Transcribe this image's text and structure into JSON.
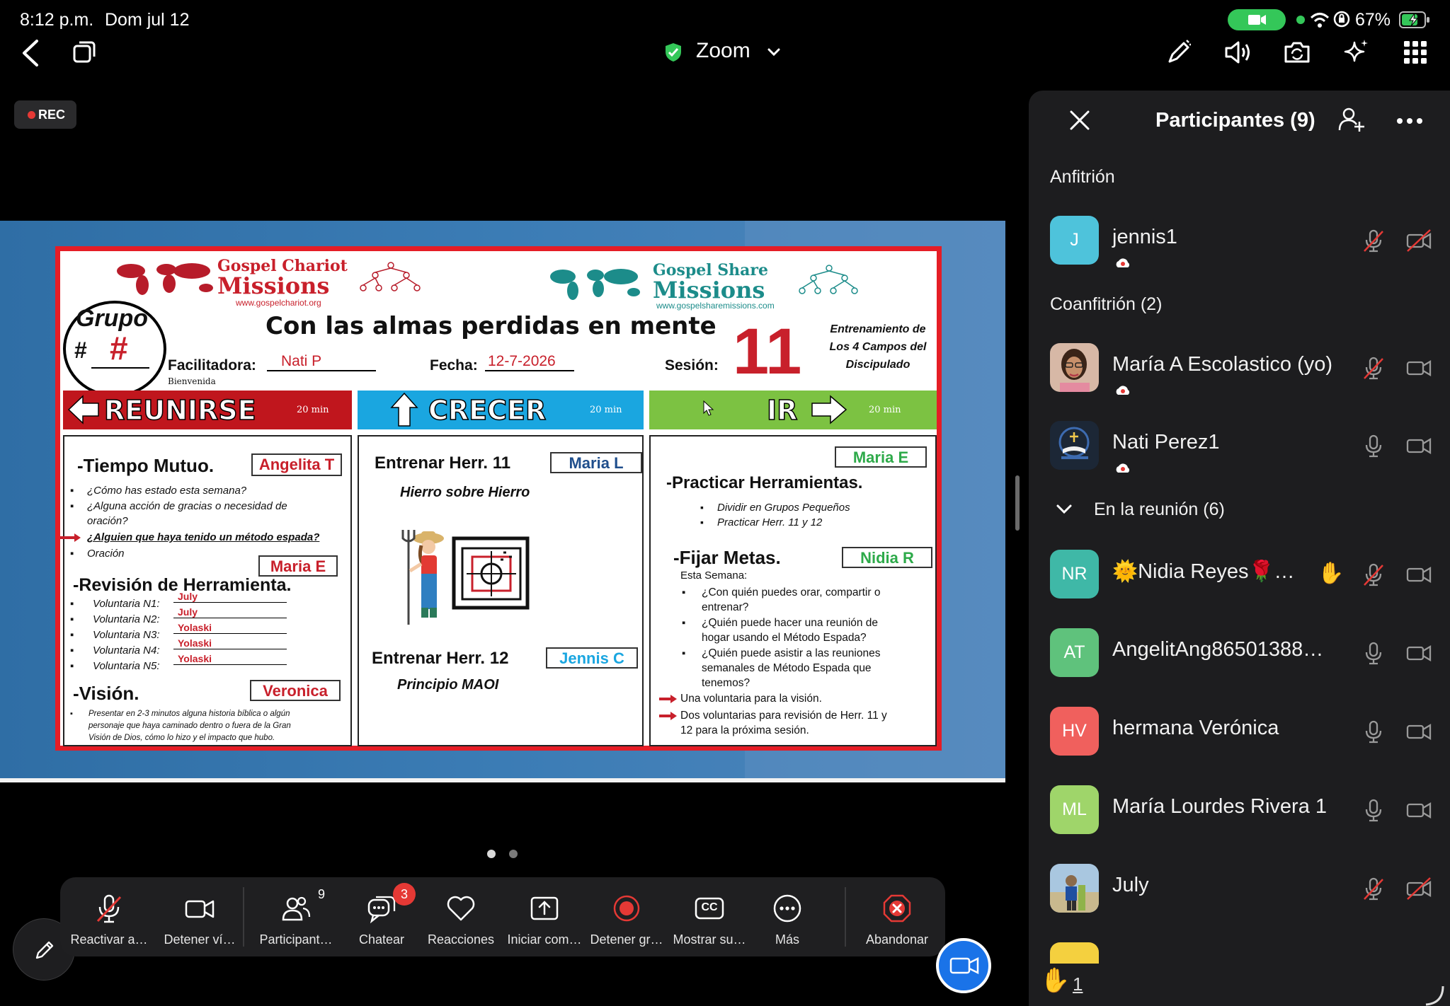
{
  "status_bar": {
    "time": "8:12 p.m.",
    "date": "Dom jul 12",
    "battery": "67%"
  },
  "top_bar": {
    "title": "Zoom"
  },
  "rec_badge": "REC",
  "slide": {
    "chariot_title": "Gospel Chariot",
    "chariot_missions": "Missions",
    "chariot_url": "www.gospelchariot.org",
    "share_title": "Gospel Share",
    "share_missions": "Missions",
    "share_url": "www.gospelsharemissions.com",
    "grupo": "Grupo",
    "grupo_hash": "#",
    "grupo_num": "#",
    "main_title": "Con las almas perdidas en mente",
    "training_1": "Entrenamiento de",
    "training_2": "Los 4 Campos del",
    "training_3": "Discipulado",
    "facilitadora_label": "Facilitadora:",
    "facilitadora_value": "Nati P",
    "bienvenida": "Bienvenida",
    "fecha_label": "Fecha:",
    "fecha_value": "12-7-2026",
    "sesion_label": "Sesión:",
    "sesion_value": "11",
    "bar_reunirse": "REUNIRSE",
    "bar_crecer": "CRECER",
    "bar_ir": "IR",
    "bar_min": "20 min",
    "col1": {
      "h1": "-Tiempo Mutuo.",
      "b1": "Angelita T",
      "l1": "¿Cómo has estado esta semana?",
      "l2": "¿Alguna acción de gracias o necesidad de",
      "l3": "oración?",
      "l4": "¿Alguien que haya tenido un método espada?",
      "l5": "Oración",
      "b2": "Maria E",
      "h2": "-Revisión de Herramienta.",
      "v1": "Voluntaria N1:",
      "v1n": "July",
      "v2": "Voluntaria N2:",
      "v2n": "July",
      "v3": "Voluntaria N3:",
      "v3n": "Yolaski",
      "v4": "Voluntaria N4:",
      "v4n": "Yolaski",
      "v5": "Voluntaria N5:",
      "v5n": "Yolaski",
      "h3": "-Visión.",
      "b3": "Veronica",
      "p1": "Presentar en 2-3 minutos alguna historia bíblica o algún",
      "p2": "personaje que haya caminado dentro o fuera de la Gran",
      "p3": "Visión de Dios, cómo lo hizo y el impacto que hubo."
    },
    "col2": {
      "h1": "Entrenar Herr. 11",
      "b1": "Maria L",
      "s1": "Hierro sobre Hierro",
      "h2": "Entrenar Herr. 12",
      "b2": "Jennis C",
      "s2": "Principio MAOI"
    },
    "col3": {
      "b1": "Maria E",
      "h1": "-Practicar Herramientas.",
      "l1": "Dividir en Grupos Pequeños",
      "l2": "Practicar Herr. 11 y 12",
      "h2": "-Fijar Metas.",
      "b2": "Nidia R",
      "sem": "Esta Semana:",
      "q1a": "¿Con quién puedes orar, compartir o",
      "q1b": "entrenar?",
      "q2a": "¿Quién puede hacer una reunión de",
      "q2b": "hogar usando el Método Espada?",
      "q3a": "¿Quién puede asistir a las reuniones",
      "q3b": "semanales de Método Espada que",
      "q3c": "tenemos?",
      "r1": "Una voluntaria para la visión.",
      "r2a": "Dos voluntarias para revisión de Herr. 11 y",
      "r2b": "12 para la próxima sesión."
    }
  },
  "panel": {
    "title": "Participantes (9)",
    "host_section": "Anfitrión",
    "cohost_section": "Coanfitrión (2)",
    "meeting_section": "En la reunión (6)",
    "participants": [
      {
        "initials": "J",
        "name": "jennis1",
        "color": "#4ec3db"
      },
      {
        "initials": "",
        "name": "María A Escolastico (yo)",
        "color": "#c9a48a"
      },
      {
        "initials": "",
        "name": "Nati Perez1",
        "color": "#2a3a4c"
      },
      {
        "initials": "NR",
        "name": "🌞Nidia Reyes🌹…",
        "color": "#3fb8a7"
      },
      {
        "initials": "AT",
        "name": "AngelitAng86501388…",
        "color": "#5fc27c"
      },
      {
        "initials": "HV",
        "name": "hermana Verónica",
        "color": "#f0605d"
      },
      {
        "initials": "ML",
        "name": "María Lourdes Rivera 1",
        "color": "#9fd56a"
      },
      {
        "initials": "",
        "name": "July",
        "color": "#9bb6cc"
      }
    ],
    "raised_hands": "1"
  },
  "toolbar": {
    "unmute": "Reactivar a…",
    "stop_video": "Detener ví…",
    "participants": "Participant…",
    "participants_count": "9",
    "chat": "Chatear",
    "chat_badge": "3",
    "reactions": "Reacciones",
    "share": "Iniciar com…",
    "record": "Detener gr…",
    "captions": "Mostrar su…",
    "cc": "CC",
    "more": "Más",
    "leave": "Abandonar"
  }
}
